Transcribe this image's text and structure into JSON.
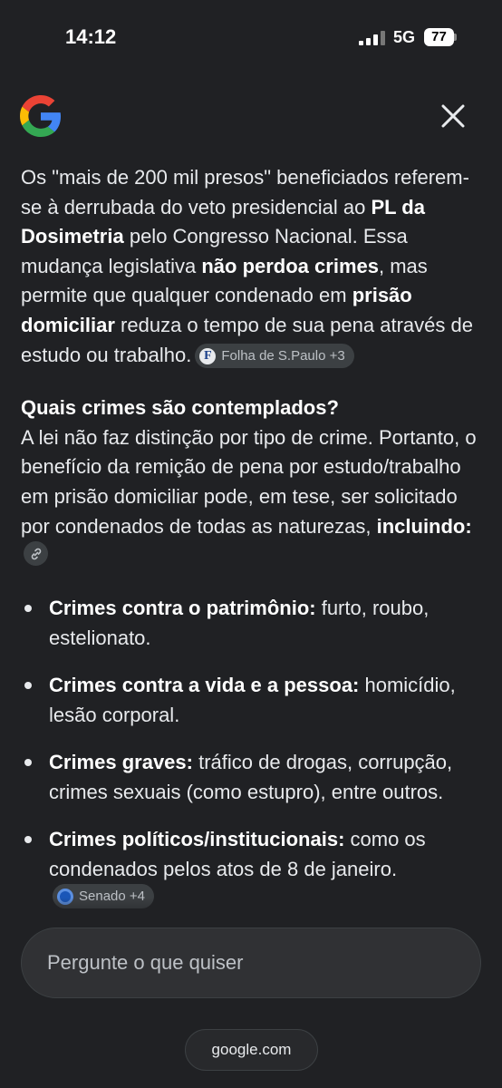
{
  "status_bar": {
    "time": "14:12",
    "network": "5G",
    "battery": "77"
  },
  "header": {
    "logo_icon": "google-g-icon",
    "close_icon": "close-icon"
  },
  "answer": {
    "p1_a": "Os \"mais de 200 mil presos\" beneficiados referem-se à derrubada do veto presidencial ao ",
    "p1_b1": "PL da Dosimetria",
    "p1_c": " pelo Congresso Nacional. Essa mudança legislativa ",
    "p1_b2": "não perdoa crimes",
    "p1_d": ", mas permite que qualquer condenado em ",
    "p1_b3": "prisão domiciliar",
    "p1_e": " reduza o tempo de sua pena através de estudo ou trabalho.",
    "source1": "Folha de S.Paulo +3",
    "heading": "Quais crimes são contemplados?",
    "p2_a": "A lei não faz distinção por tipo de crime. Portanto, o benefício da remição de pena por estudo/trabalho em prisão domiciliar pode, em tese, ser solicitado por condenados de todas as naturezas, ",
    "p2_b": "incluindo:",
    "bullets": [
      {
        "label": "Crimes contra o patrimônio:",
        "text": " furto, roubo, estelionato."
      },
      {
        "label": "Crimes contra a vida e a pessoa:",
        "text": " homicídio, lesão corporal."
      },
      {
        "label": "Crimes graves:",
        "text": " tráfico de drogas, corrupção, crimes sexuais (como estupro), entre outros."
      },
      {
        "label": "Crimes políticos/institucionais:",
        "text": " como os condenados pelos atos de 8 de janeiro."
      }
    ],
    "source2": "Senado +4"
  },
  "ask": {
    "placeholder": "Pergunte o que quiser"
  },
  "footer": {
    "domain": "google.com"
  },
  "colors": {
    "background": "#202124",
    "chip": "#3c4043",
    "input": "#303134"
  }
}
